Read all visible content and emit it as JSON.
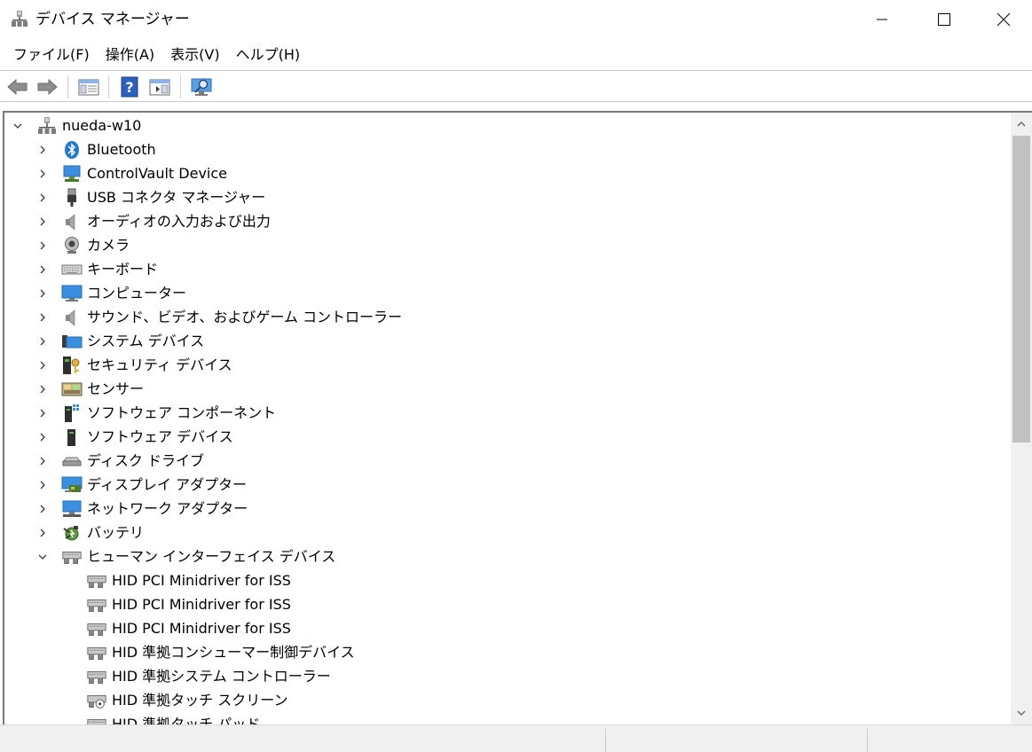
{
  "window": {
    "title": "デバイス マネージャー",
    "icon": "device-manager-icon"
  },
  "menu": {
    "items": [
      "ファイル(F)",
      "操作(A)",
      "表示(V)",
      "ヘルプ(H)"
    ]
  },
  "toolbar": {
    "buttons": [
      "back-arrow-icon",
      "forward-arrow-icon",
      "properties-console-icon",
      "help-icon",
      "update-driver-icon",
      "scan-hardware-icon"
    ]
  },
  "tree": {
    "root": "nueda-w10",
    "categories": [
      "Bluetooth",
      "ControlVault Device",
      "USB コネクタ マネージャー",
      "オーディオの入力および出力",
      "カメラ",
      "キーボード",
      "コンピューター",
      "サウンド、ビデオ、およびゲーム コントローラー",
      "システム デバイス",
      "セキュリティ デバイス",
      "センサー",
      "ソフトウェア コンポーネント",
      "ソフトウェア デバイス",
      "ディスク ドライブ",
      "ディスプレイ アダプター",
      "ネットワーク アダプター",
      "バッテリ",
      "ヒューマン インターフェイス デバイス"
    ],
    "hid_children": [
      "HID PCI Minidriver for ISS",
      "HID PCI Minidriver for ISS",
      "HID PCI Minidriver for ISS",
      "HID 準拠コンシューマー制御デバイス",
      "HID 準拠システム コントローラー",
      "HID 準拠タッチ スクリーン",
      "HID 準拠タッチ パッド"
    ]
  },
  "colors": {
    "bluetooth": "#1e78d7",
    "monitor": "#3b8fe0",
    "scroll_thumb": "#c1c1c1"
  }
}
